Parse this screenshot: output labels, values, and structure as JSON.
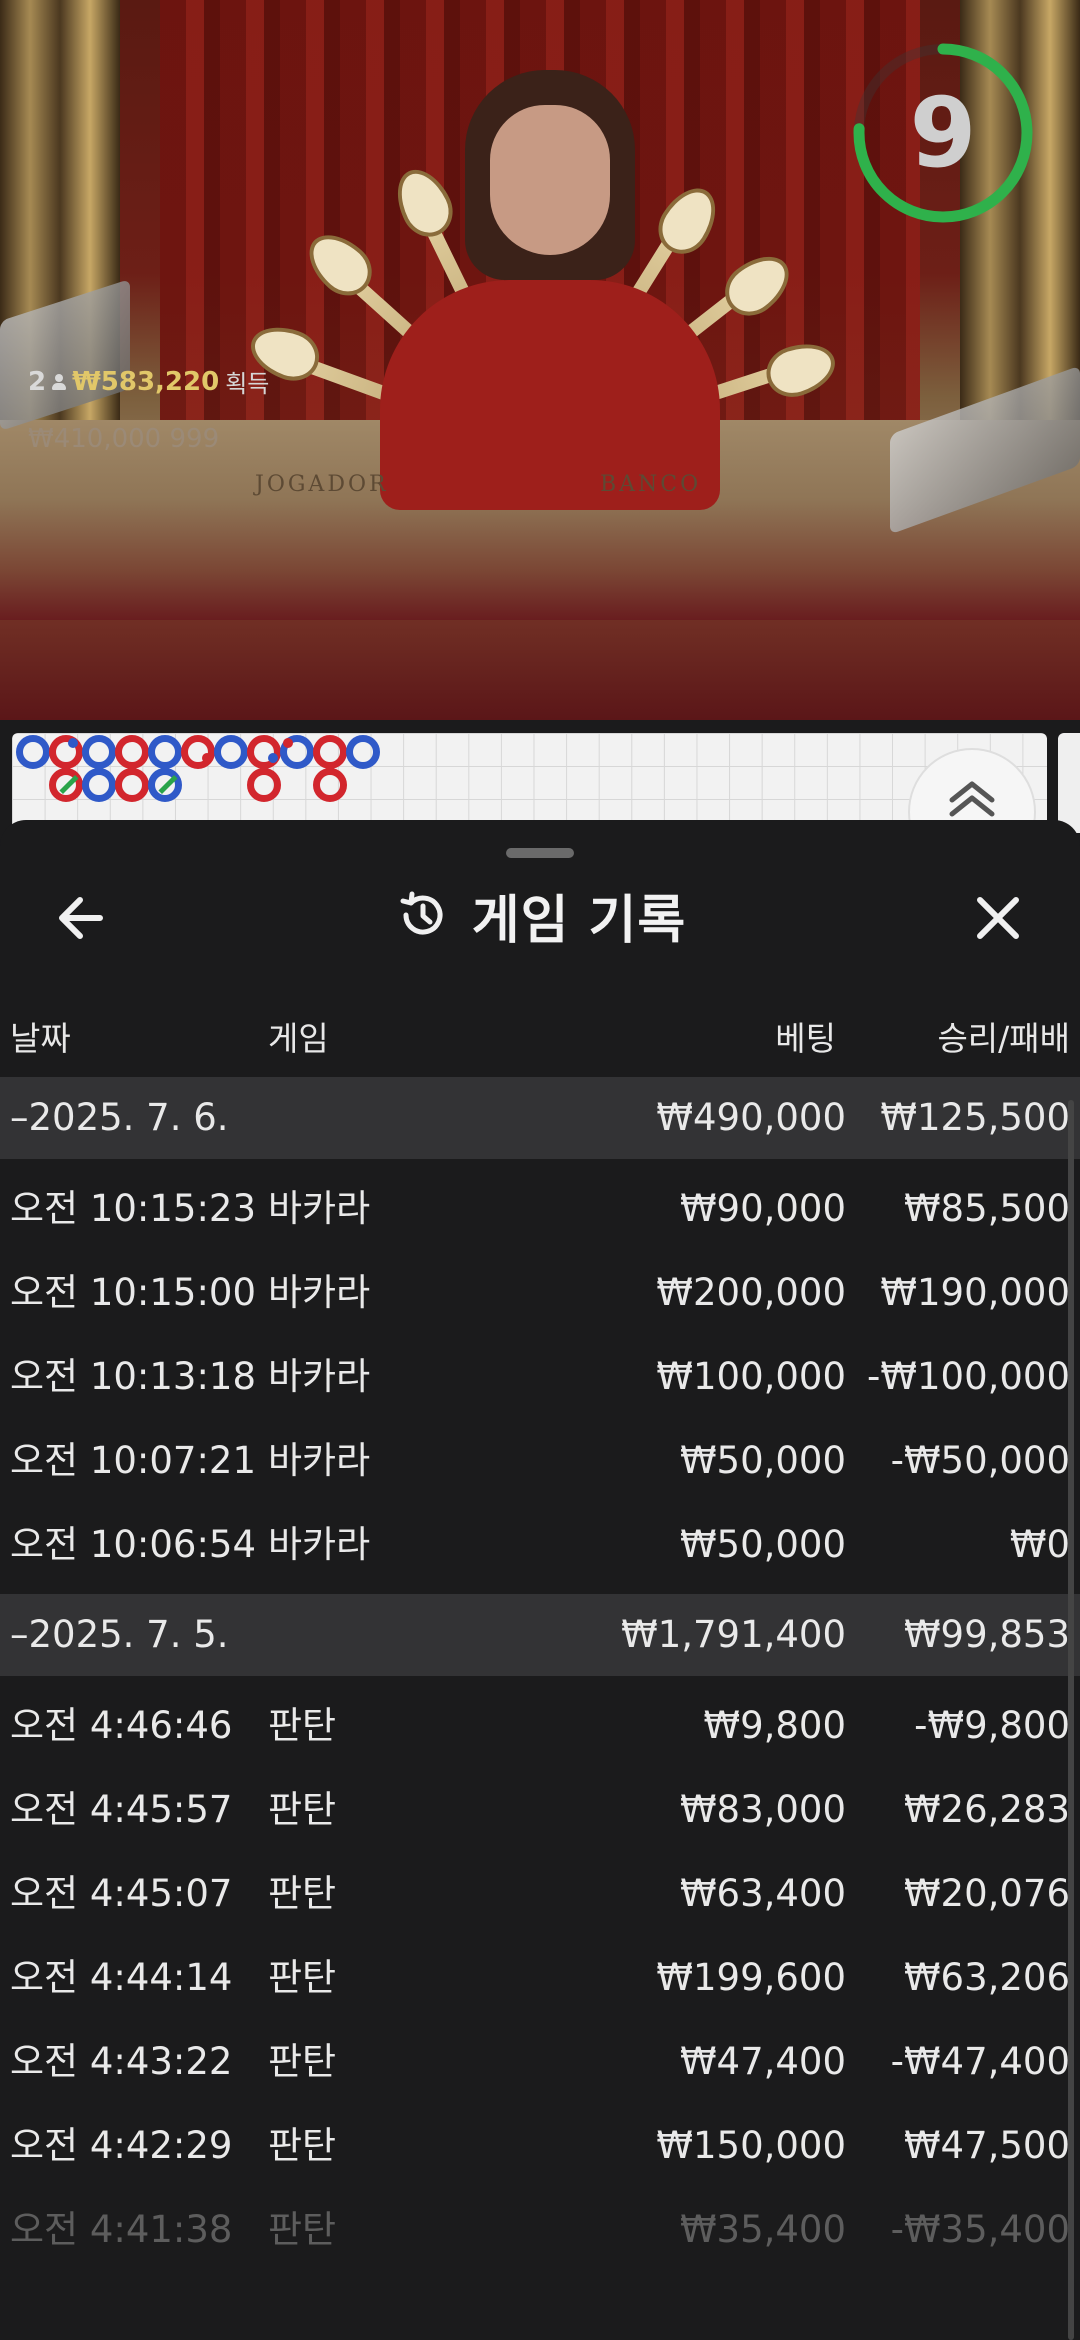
{
  "scene": {
    "table_text_left": "JOGADOR",
    "table_text_right": "BANCO",
    "winner": {
      "count": "2",
      "amount": "₩583,220",
      "label": "획득"
    },
    "faded_line": "₩410,000  999",
    "timer": "9"
  },
  "sheet": {
    "title": "게임 기록",
    "columns": {
      "date": "날짜",
      "game": "게임",
      "bet": "베팅",
      "result": "승리/패배"
    },
    "sections": [
      {
        "date": "–2025. 7. 6.",
        "bet": "₩490,000",
        "result": "₩125,500",
        "rows": [
          {
            "time": "오전 10:15:23",
            "game": "바카라",
            "bet": "₩90,000",
            "result": "₩85,500"
          },
          {
            "time": "오전 10:15:00",
            "game": "바카라",
            "bet": "₩200,000",
            "result": "₩190,000"
          },
          {
            "time": "오전 10:13:18",
            "game": "바카라",
            "bet": "₩100,000",
            "result": "-₩100,000"
          },
          {
            "time": "오전 10:07:21",
            "game": "바카라",
            "bet": "₩50,000",
            "result": "-₩50,000"
          },
          {
            "time": "오전 10:06:54",
            "game": "바카라",
            "bet": "₩50,000",
            "result": "₩0"
          }
        ]
      },
      {
        "date": "–2025. 7. 5.",
        "bet": "₩1,791,400",
        "result": "₩99,853",
        "rows": [
          {
            "time": "오전 4:46:46",
            "game": "판탄",
            "bet": "₩9,800",
            "result": "-₩9,800"
          },
          {
            "time": "오전 4:45:57",
            "game": "판탄",
            "bet": "₩83,000",
            "result": "₩26,283"
          },
          {
            "time": "오전 4:45:07",
            "game": "판탄",
            "bet": "₩63,400",
            "result": "₩20,076"
          },
          {
            "time": "오전 4:44:14",
            "game": "판탄",
            "bet": "₩199,600",
            "result": "₩63,206"
          },
          {
            "time": "오전 4:43:22",
            "game": "판탄",
            "bet": "₩47,400",
            "result": "-₩47,400"
          },
          {
            "time": "오전 4:42:29",
            "game": "판탄",
            "bet": "₩150,000",
            "result": "₩47,500"
          },
          {
            "time": "오전 4:41:38",
            "game": "판탄",
            "bet": "₩35,400",
            "result": "-₩35,400"
          }
        ]
      }
    ]
  },
  "colors": {
    "accent_green": "#2fb14b",
    "win_gold": "#e1c769",
    "banker_red": "#d2262d",
    "player_blue": "#2f59c8"
  },
  "icons": {
    "back": "arrow-left-icon",
    "history": "history-clock-icon",
    "close": "close-icon",
    "expand": "chevron-double-up-icon"
  }
}
